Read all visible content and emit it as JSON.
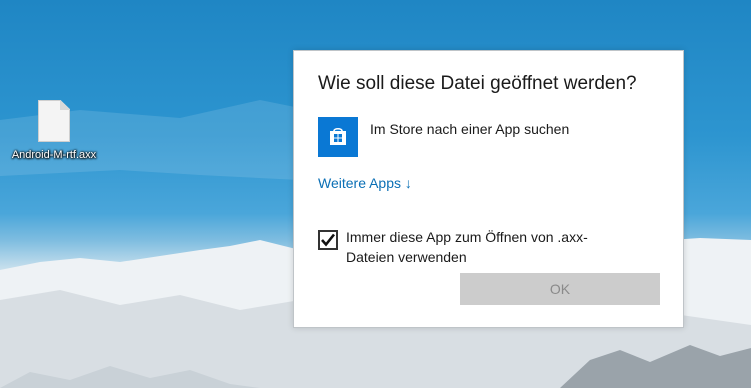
{
  "desktop": {
    "file_icon": {
      "label": "Android-M-rtf.axx",
      "icon": "file-icon"
    }
  },
  "dialog": {
    "title": "Wie soll diese Datei geöffnet werden?",
    "store_option": {
      "label": "Im Store nach einer App suchen",
      "icon": "store-icon",
      "tile_color": "#0a78d4"
    },
    "more_apps": {
      "label": "Weitere Apps",
      "icon": "arrow-down-icon"
    },
    "always_use": {
      "line1": "Immer diese App zum Öffnen von .axx-",
      "line2": "Dateien verwenden",
      "checked": true
    },
    "ok_label": "OK"
  },
  "colors": {
    "accent": "#0a78d4",
    "link": "#0a6fb5"
  }
}
